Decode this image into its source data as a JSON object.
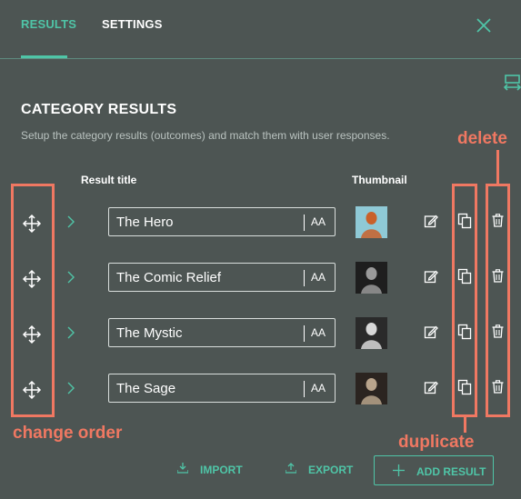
{
  "tabs": [
    {
      "label": "RESULTS",
      "active": true
    },
    {
      "label": "SETTINGS",
      "active": false
    }
  ],
  "header": {
    "title": "CATEGORY RESULTS",
    "subtitle": "Setup the category results (outcomes) and match them with user responses."
  },
  "columns": {
    "title": "Result title",
    "thumbnail": "Thumbnail"
  },
  "results": [
    {
      "title": "The Hero",
      "font_button": "AA"
    },
    {
      "title": "The Comic Relief",
      "font_button": "AA"
    },
    {
      "title": "The Mystic",
      "font_button": "AA"
    },
    {
      "title": "The Sage",
      "font_button": "AA"
    }
  ],
  "annotations": {
    "change_order": "change order",
    "duplicate": "duplicate",
    "delete": "delete"
  },
  "footer": {
    "import_label": "IMPORT",
    "export_label": "EXPORT",
    "add_label": "ADD RESULT"
  },
  "colors": {
    "background": "#4d5553",
    "accent": "#4fc5a7",
    "annotation": "#f07862"
  },
  "icons": [
    "close-icon",
    "preview-icon",
    "move-icon",
    "chevron-right-icon",
    "edit-icon",
    "duplicate-icon",
    "trash-icon",
    "import-icon",
    "export-icon",
    "plus-icon"
  ]
}
